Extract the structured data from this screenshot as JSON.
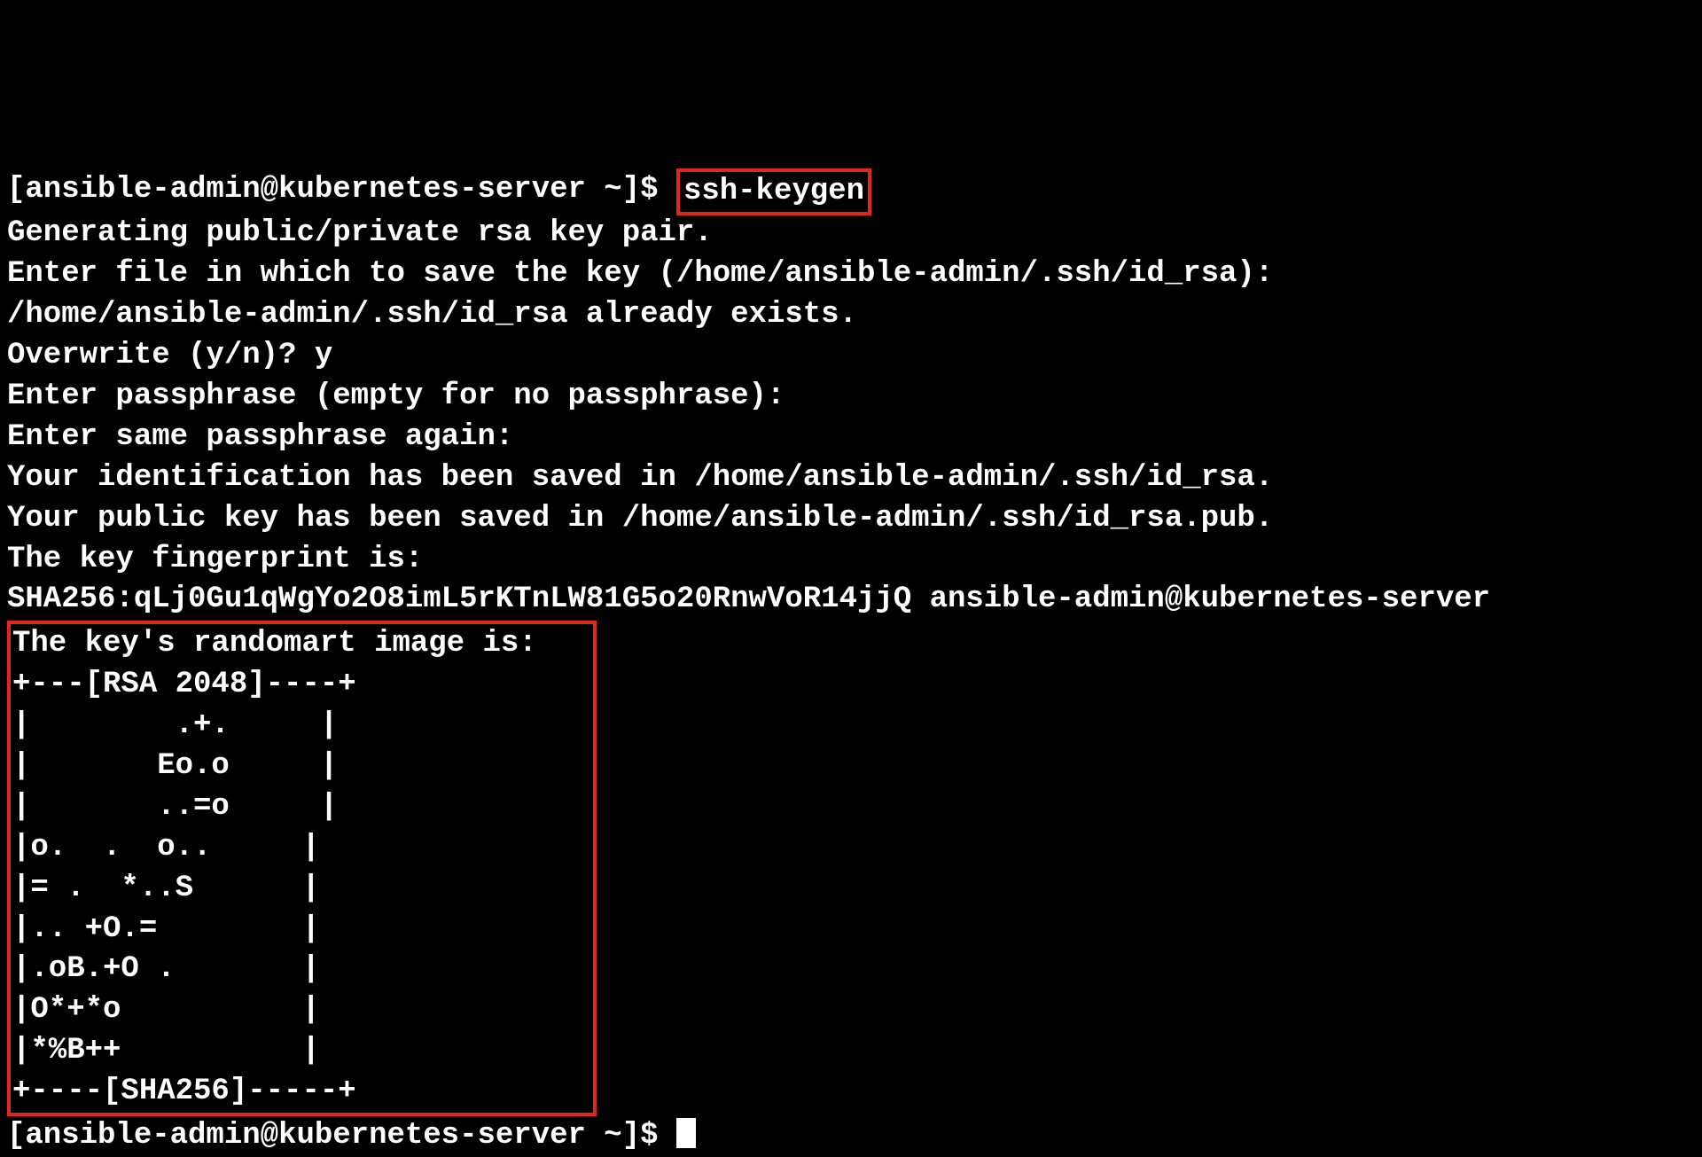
{
  "prompt": "[ansible-admin@kubernetes-server ~]$ ",
  "command": "ssh-keygen",
  "out": {
    "l1": "Generating public/private rsa key pair.",
    "l2": "Enter file in which to save the key (/home/ansible-admin/.ssh/id_rsa):",
    "l3": "/home/ansible-admin/.ssh/id_rsa already exists.",
    "l4": "Overwrite (y/n)? y",
    "l5": "Enter passphrase (empty for no passphrase):",
    "l6": "Enter same passphrase again:",
    "l7": "Your identification has been saved in /home/ansible-admin/.ssh/id_rsa.",
    "l8": "Your public key has been saved in /home/ansible-admin/.ssh/id_rsa.pub.",
    "l9": "The key fingerprint is:",
    "l10": "SHA256:qLj0Gu1qWgYo2O8imL5rKTnLW81G5o20RnwVoR14jjQ ansible-admin@kubernetes-server"
  },
  "art": {
    "a0": "The key's randomart image is:   ",
    "a1": "+---[RSA 2048]----+             ",
    "a2": "|        .+.     |             ",
    "a3": "|       Eo.o     |             ",
    "a4": "|       ..=o     |             ",
    "a5": "|o.  .  o..     |             ",
    "a6": "|= .  *..S      |             ",
    "a7": "|.. +O.=        |             ",
    "a8": "|.oB.+O .       |             ",
    "a9": "|O*+*o          |             ",
    "a10": "|*%B++          |             ",
    "a11": "+----[SHA256]-----+           "
  },
  "prompt2": "[ansible-admin@kubernetes-server ~]$ "
}
